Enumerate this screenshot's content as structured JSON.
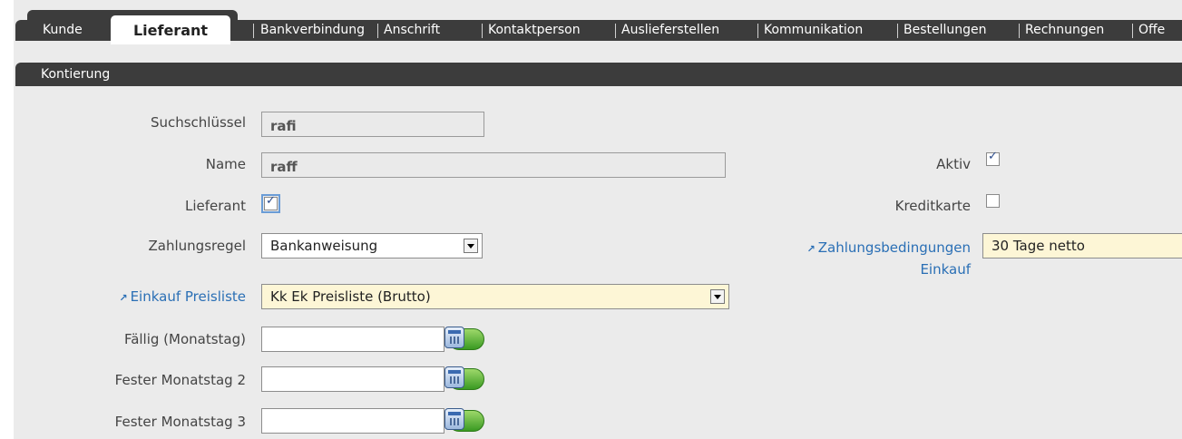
{
  "tabs": {
    "kunde": "Kunde",
    "lieferant": "Lieferant",
    "bankverbindung": "Bankverbindung",
    "anschrift": "Anschrift",
    "kontaktperson": "Kontaktperson",
    "auslieferstellen": "Auslieferstellen",
    "kommunikation": "Kommunikation",
    "bestellungen": "Bestellungen",
    "rechnungen": "Rechnungen",
    "offe": "Offe"
  },
  "subtabs": {
    "kontierung": "Kontierung"
  },
  "form": {
    "suchschluessel_label": "Suchschlüssel",
    "suchschluessel_value": "rafi",
    "name_label": "Name",
    "name_value": "raff",
    "lieferant_label": "Lieferant",
    "lieferant_checked": true,
    "zahlungsregel_label": "Zahlungsregel",
    "zahlungsregel_value": "Bankanweisung",
    "einkauf_preisliste_label": "Einkauf Preisliste",
    "einkauf_preisliste_value": "Kk Ek Preisliste (Brutto)",
    "faellig_label": "Fällig (Monatstag)",
    "faellig_value": "",
    "fester2_label": "Fester Monatstag 2",
    "fester2_value": "",
    "fester3_label": "Fester Monatstag 3",
    "fester3_value": "",
    "aktiv_label": "Aktiv",
    "aktiv_checked": true,
    "kreditkarte_label": "Kreditkarte",
    "kreditkarte_checked": false,
    "zahlungsbedingungen_label_1": "Zahlungsbedingungen",
    "zahlungsbedingungen_label_2": "Einkauf",
    "zahlungsbedingungen_value": "30 Tage netto"
  },
  "icons": {
    "calendar": "calendar-icon",
    "link_arrow": "link-arrow-icon",
    "dropdown": "chevron-down-icon",
    "check": "check-icon"
  },
  "colors": {
    "tab_bar": "#3c3c3c",
    "link": "#2a6fb5",
    "lookup_field": "#fdf6d6",
    "panel": "#ebebeb"
  }
}
